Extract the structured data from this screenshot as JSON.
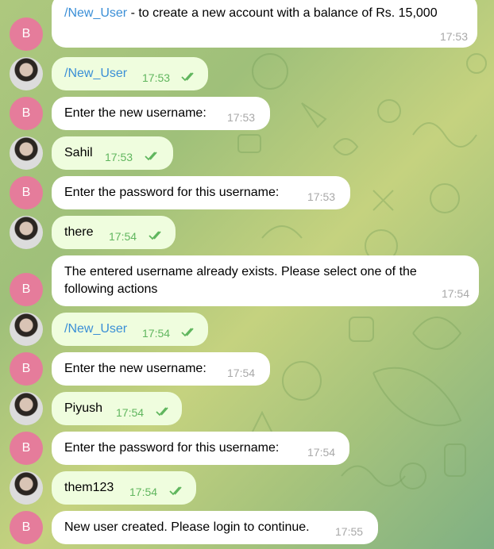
{
  "chat": {
    "messages": [
      {
        "sender": "bot",
        "avatar": "B",
        "command": "/New_User",
        "text": " - to create a new account with a balance of Rs. 15,000",
        "time": "17:53"
      },
      {
        "sender": "user",
        "command": "/New_User",
        "time": "17:53",
        "read": true
      },
      {
        "sender": "bot",
        "avatar": "B",
        "text": "Enter the new username:",
        "time": "17:53"
      },
      {
        "sender": "user",
        "text": "Sahil",
        "time": "17:53",
        "read": true
      },
      {
        "sender": "bot",
        "avatar": "B",
        "text": "Enter the password for this username:",
        "time": "17:53"
      },
      {
        "sender": "user",
        "text": "there",
        "time": "17:54",
        "read": true
      },
      {
        "sender": "bot",
        "avatar": "B",
        "text": "The entered username already exists. Please select one of the following actions",
        "time": "17:54"
      },
      {
        "sender": "user",
        "command": "/New_User",
        "time": "17:54",
        "read": true
      },
      {
        "sender": "bot",
        "avatar": "B",
        "text": "Enter the new username:",
        "time": "17:54"
      },
      {
        "sender": "user",
        "text": "Piyush",
        "time": "17:54",
        "read": true
      },
      {
        "sender": "bot",
        "avatar": "B",
        "text": "Enter the password for this username:",
        "time": "17:54"
      },
      {
        "sender": "user",
        "text": "them123",
        "time": "17:54",
        "read": true
      },
      {
        "sender": "bot",
        "avatar": "B",
        "text": "New user created. Please login to continue.",
        "time": "17:55"
      }
    ]
  },
  "colors": {
    "bot_avatar": "#e57c9b",
    "incoming_bubble": "#ffffff",
    "outgoing_bubble": "#effdde",
    "command_link": "#3a8fd6",
    "read_check": "#60b65e"
  },
  "icons": {
    "read_receipt": "double-check-icon"
  }
}
